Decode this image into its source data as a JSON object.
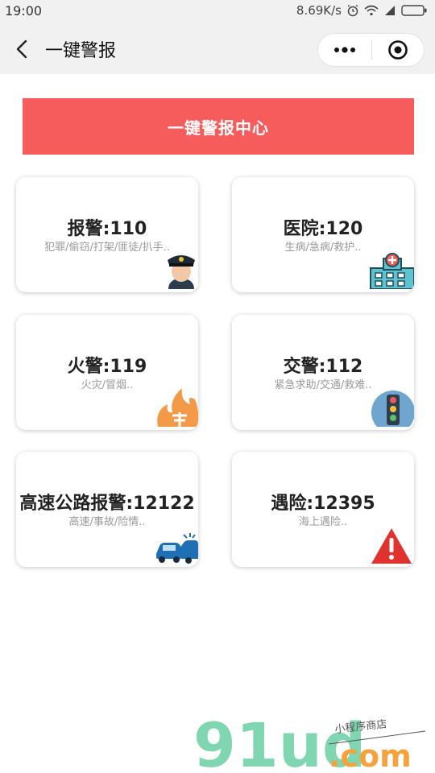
{
  "status_bar": {
    "time": "19:00",
    "speed": "8.69K/s"
  },
  "nav": {
    "title": "一键警报"
  },
  "banner": {
    "label": "一键警报中心"
  },
  "cards": [
    {
      "title": "报警:110",
      "subtitle": "犯罪/偷窃/打架/匪徒/扒手..",
      "icon": "police-officer-icon"
    },
    {
      "title": "医院:120",
      "subtitle": "生病/急病/救护..",
      "icon": "hospital-icon"
    },
    {
      "title": "火警:119",
      "subtitle": "火灾/冒烟..",
      "icon": "fire-icon"
    },
    {
      "title": "交警:112",
      "subtitle": "紧急求助/交通/救难..",
      "icon": "traffic-light-icon"
    },
    {
      "title": "高速公路报警:12122",
      "subtitle": "高速/事故/险情..",
      "icon": "car-accident-icon"
    },
    {
      "title": "遇险:12395",
      "subtitle": "海上遇险..",
      "icon": "warning-icon"
    }
  ],
  "watermark": {
    "brand": "91ud",
    "domain": ".com",
    "tagline": "小程序商店"
  },
  "colors": {
    "banner": "#f75c5c",
    "watermark_green": "#7fd6b0",
    "watermark_orange": "#f6a23c"
  }
}
